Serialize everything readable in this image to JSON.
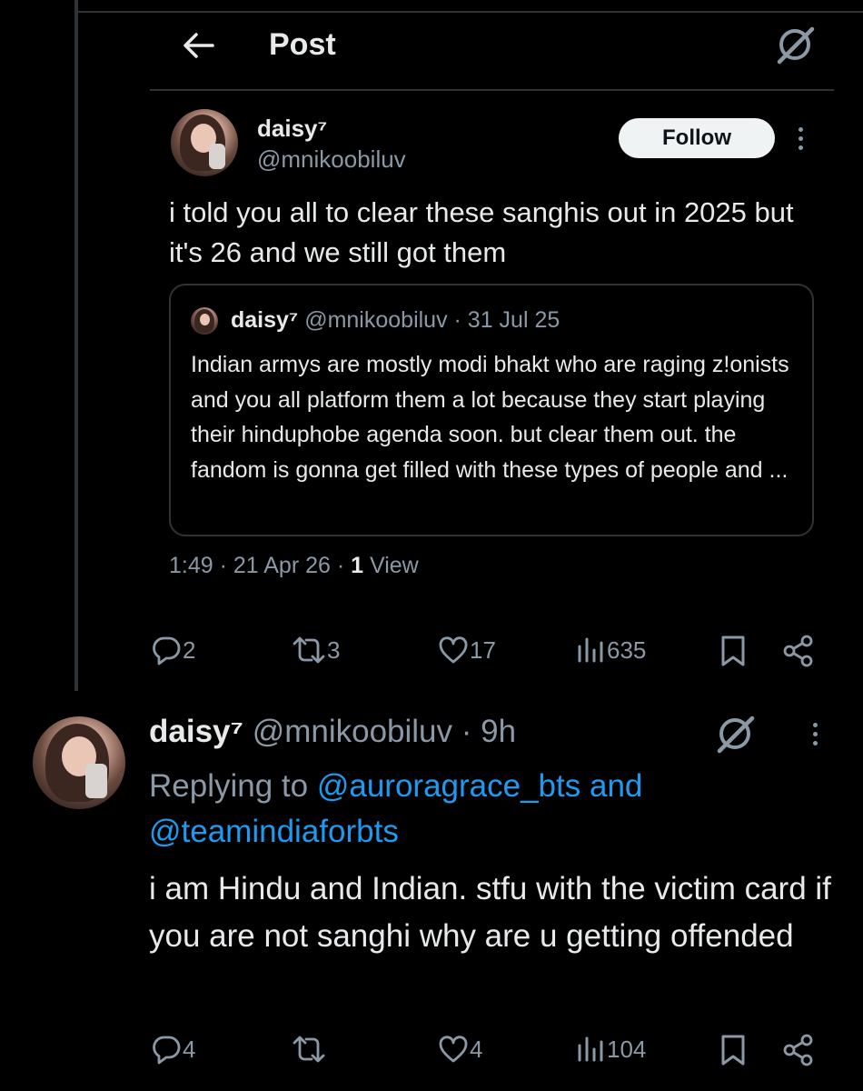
{
  "header": {
    "title": "Post"
  },
  "main_post": {
    "author_name": "daisy⁷",
    "author_handle": "@mnikoobiluv",
    "follow_label": "Follow",
    "text": "i told you all to clear these sanghis out in 2025 but it's 26 and we still got them",
    "quote": {
      "author_name": "daisy⁷",
      "author_handle_date": "@mnikoobiluv · 31 Jul 25",
      "text": "Indian armys are mostly modi bhakt who are raging z!onists and you all platform them a lot because they start playing their hinduphobe agenda soon. but clear them out. the fandom is gonna get filled with these types of people and ..."
    },
    "meta_time": "1:49 · 21 Apr 26 · ",
    "meta_views_count": "1",
    "meta_views_label": " View",
    "actions": {
      "replies": "2",
      "reposts": "3",
      "likes": "17",
      "views": "635"
    }
  },
  "reply": {
    "author_name": "daisy⁷",
    "author_handle_time": "@mnikoobiluv · 9h",
    "replying_prefix": "Replying to ",
    "mention_1": "@auroragrace_bts",
    "mention_joiner": " and",
    "mention_2": "@teamindiaforbts",
    "text": "i am Hindu and Indian. stfu with the victim card if you are not sanghi why are u getting offended",
    "actions": {
      "replies": "4",
      "reposts": "",
      "likes": "4",
      "views": "104"
    }
  },
  "icons": {
    "back": "back-arrow-icon",
    "grok": "grok-icon",
    "reply": "reply-icon",
    "repost": "repost-icon",
    "like": "heart-icon",
    "views": "views-icon",
    "bookmark": "bookmark-icon",
    "share": "share-icon",
    "more": "more-vertical-icon"
  },
  "colors": {
    "background": "#000000",
    "text": "#e7e9ea",
    "secondary": "#8b98a5",
    "link": "#1d9bf0",
    "border": "#2f3336"
  }
}
